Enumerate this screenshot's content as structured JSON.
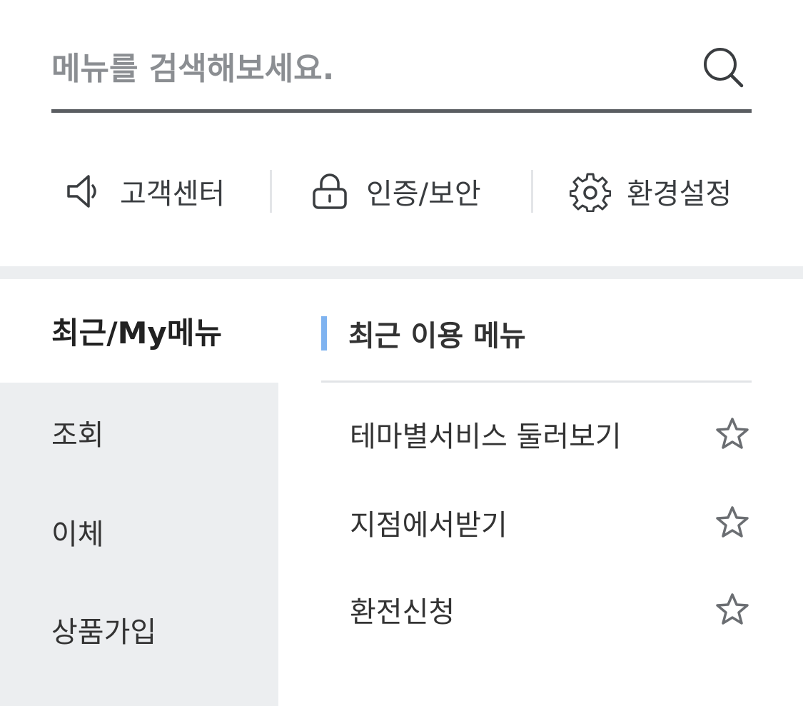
{
  "search": {
    "placeholder": "메뉴를 검색해보세요.",
    "value": "",
    "icon": "search-icon"
  },
  "quick_links": [
    {
      "label": "고객센터",
      "icon": "megaphone-icon"
    },
    {
      "label": "인증/보안",
      "icon": "lock-icon"
    },
    {
      "label": "환경설정",
      "icon": "gear-icon"
    }
  ],
  "sidebar": {
    "items": [
      {
        "label": "최근/My메뉴",
        "active": true
      },
      {
        "label": "조회",
        "active": false
      },
      {
        "label": "이체",
        "active": false
      },
      {
        "label": "상품가입",
        "active": false
      }
    ]
  },
  "content": {
    "section_title": "최근 이용 메뉴",
    "accent_color": "#7fb3f0",
    "items": [
      {
        "label": "테마별서비스 둘러보기",
        "icon": "star-outline-icon"
      },
      {
        "label": "지점에서받기",
        "icon": "star-outline-icon"
      },
      {
        "label": "환전신청",
        "icon": "star-outline-icon"
      }
    ]
  }
}
